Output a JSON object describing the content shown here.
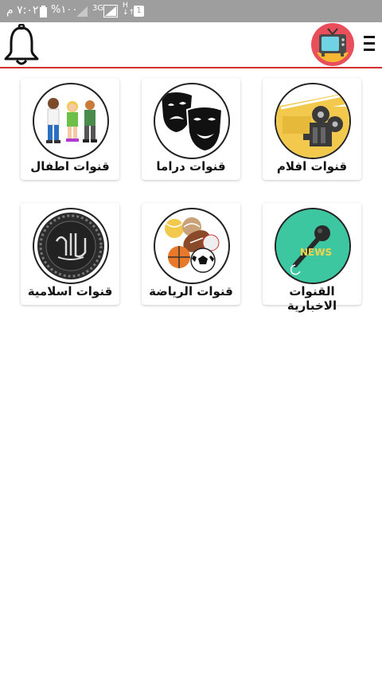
{
  "status_bar": {
    "time": "٧:٠٢ م",
    "battery": "%١٠٠",
    "network": "3G",
    "notification_badge": "1"
  },
  "app_bar": {
    "accent_color": "#d32f2f",
    "icons": [
      "bell-icon",
      "tv-logo",
      "menu-icon"
    ]
  },
  "categories": [
    {
      "label": "قنوات افلام",
      "icon": "film-reel-icon"
    },
    {
      "label": "قنوات دراما",
      "icon": "drama-masks-icon"
    },
    {
      "label": "قنوات اطفال",
      "icon": "kids-icon"
    },
    {
      "label": "القنوات الاخبارية",
      "icon": "news-microphone-icon"
    },
    {
      "label": "قنوات الرياضة",
      "icon": "sports-balls-icon"
    },
    {
      "label": "قنوات اسلامية",
      "icon": "islamic-emblem-icon"
    }
  ]
}
